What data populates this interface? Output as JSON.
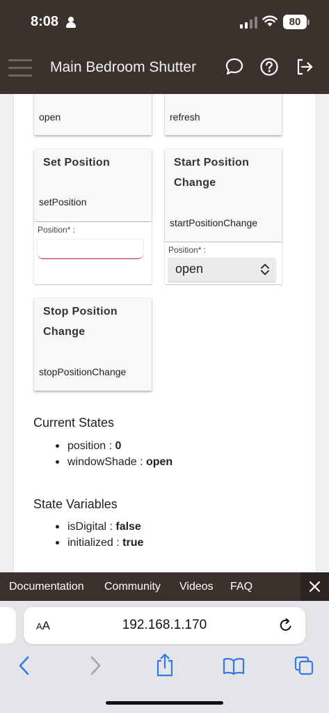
{
  "status_bar": {
    "time": "8:08",
    "battery": "80",
    "icons": [
      "person-icon",
      "cellular-signal-icon",
      "wifi-icon",
      "battery-icon"
    ]
  },
  "header": {
    "title": "Main Bedroom Shutter",
    "icons": [
      "menu-icon",
      "chat-icon",
      "help-icon",
      "logout-icon"
    ]
  },
  "commands": {
    "open": {
      "name": "open"
    },
    "refresh": {
      "name": "refresh"
    },
    "set_position": {
      "title": "Set Position",
      "name": "setPosition",
      "param_label": "Position* :",
      "param_value": ""
    },
    "start_position_change": {
      "title_line1": "Start Position",
      "title_line2": "Change",
      "name": "startPositionChange",
      "param_label": "Position* :",
      "selected_option": "open"
    },
    "stop_position_change": {
      "title_line1": "Stop Position",
      "title_line2": "Change",
      "name": "stopPositionChange"
    }
  },
  "current_states": {
    "heading": "Current States",
    "items": [
      {
        "key": "position",
        "value": "0"
      },
      {
        "key": "windowShade",
        "value": "open"
      }
    ]
  },
  "state_variables": {
    "heading": "State Variables",
    "items": [
      {
        "key": "isDigital",
        "value": "false"
      },
      {
        "key": "initialized",
        "value": "true"
      }
    ]
  },
  "footer": {
    "links": [
      "Documentation",
      "Community",
      "Videos",
      "FAQ"
    ],
    "close_icon": "close-icon"
  },
  "browser": {
    "text_size_label": "AA",
    "url": "192.168.1.170",
    "icons": [
      "reload-icon",
      "back-icon",
      "forward-icon",
      "share-icon",
      "bookmarks-icon",
      "tabs-icon"
    ]
  },
  "colors": {
    "header_bg": "#3b322d",
    "input_underline": "#c7302c",
    "browser_accent": "#2f7ae5"
  }
}
